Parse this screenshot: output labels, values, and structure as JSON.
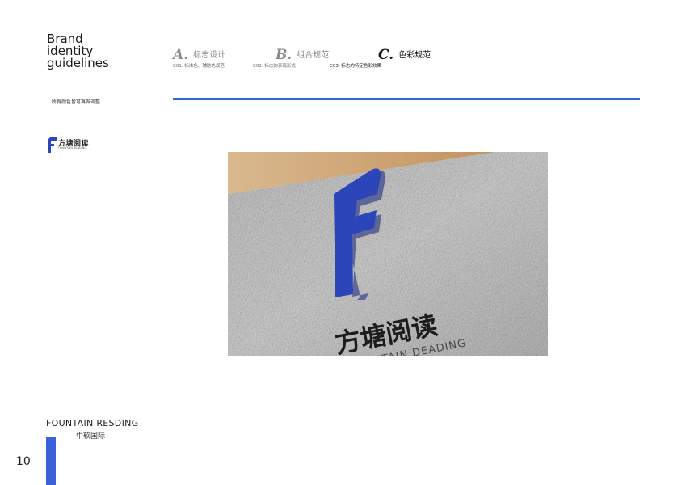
{
  "header": {
    "title_lines": [
      "Brand",
      "identity",
      "guidelines"
    ],
    "nav": [
      {
        "letter": "A.",
        "label": "标志设计",
        "sub": "C01. 标准色、辅助色规范"
      },
      {
        "letter": "B.",
        "label": "组合规范",
        "sub": "C02. 标志的表现形式"
      },
      {
        "letter": "C.",
        "label": "色彩规范",
        "sub": "C03. 标志的特定色彩效果"
      }
    ]
  },
  "note": "所有颜色皆可再做调整",
  "mini_logo": {
    "cn": "方塘阅读",
    "en": "FOUNTAIN READING"
  },
  "mockup": {
    "cn": "方塘阅读",
    "en": "FOUNTAIN DEADING"
  },
  "footer": {
    "en": "FOUNTAIN RESDING",
    "cn": "中软国际"
  },
  "page_number": "10",
  "colors": {
    "accent": "#3a62d8",
    "logo_blue": "#2c45b8"
  }
}
